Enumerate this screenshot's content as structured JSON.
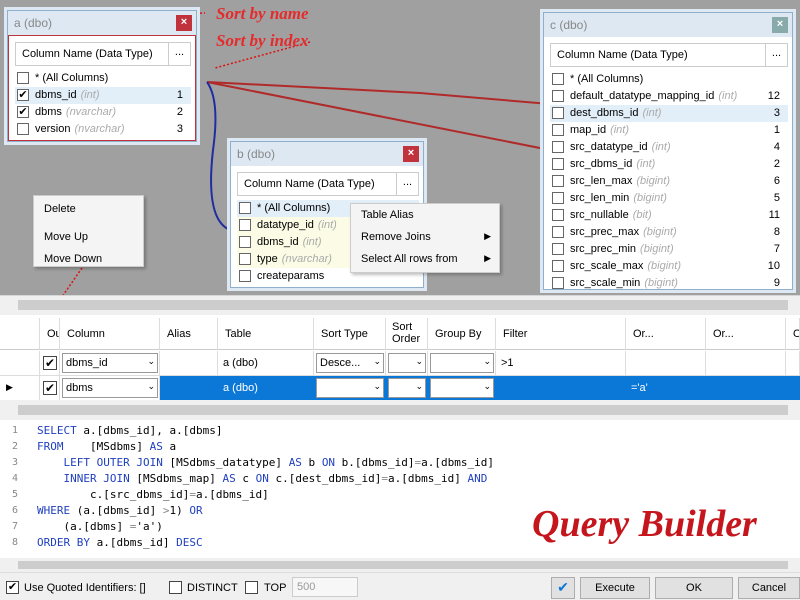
{
  "table_a": {
    "title": "a (dbo)",
    "header": "Column Name (Data Type)",
    "rows": [
      {
        "name": "* (All Columns)",
        "type": "",
        "index": "",
        "checked": ""
      },
      {
        "name": "dbms_id",
        "type": "(int)",
        "index": "1",
        "checked": "✔"
      },
      {
        "name": "dbms",
        "type": "(nvarchar)",
        "index": "2",
        "checked": "✔"
      },
      {
        "name": "version",
        "type": "(nvarchar)",
        "index": "3",
        "checked": ""
      }
    ]
  },
  "table_b": {
    "title": "b (dbo)",
    "header": "Column Name (Data Type)",
    "rows": [
      {
        "name": "* (All Columns)",
        "type": ""
      },
      {
        "name": "datatype_id",
        "type": "(int)"
      },
      {
        "name": "dbms_id",
        "type": "(int)"
      },
      {
        "name": "type",
        "type": "(nvarchar)"
      },
      {
        "name": "createparams",
        "type": ""
      }
    ]
  },
  "table_c": {
    "title": "c (dbo)",
    "header": "Column Name (Data Type)",
    "rows": [
      {
        "name": "* (All Columns)",
        "type": "",
        "index": ""
      },
      {
        "name": "default_datatype_mapping_id",
        "type": "(int)",
        "index": "12"
      },
      {
        "name": "dest_dbms_id",
        "type": "(int)",
        "index": "3"
      },
      {
        "name": "map_id",
        "type": "(int)",
        "index": "1"
      },
      {
        "name": "src_datatype_id",
        "type": "(int)",
        "index": "4"
      },
      {
        "name": "src_dbms_id",
        "type": "(int)",
        "index": "2"
      },
      {
        "name": "src_len_max",
        "type": "(bigint)",
        "index": "6"
      },
      {
        "name": "src_len_min",
        "type": "(bigint)",
        "index": "5"
      },
      {
        "name": "src_nullable",
        "type": "(bit)",
        "index": "11"
      },
      {
        "name": "src_prec_max",
        "type": "(bigint)",
        "index": "8"
      },
      {
        "name": "src_prec_min",
        "type": "(bigint)",
        "index": "7"
      },
      {
        "name": "src_scale_max",
        "type": "(bigint)",
        "index": "10"
      },
      {
        "name": "src_scale_min",
        "type": "(bigint)",
        "index": "9"
      }
    ]
  },
  "menu_left": {
    "items": [
      "Delete",
      "Move Up",
      "Move Down"
    ]
  },
  "menu_right": {
    "items": [
      "Table Alias",
      "Remove Joins",
      "Select All rows from"
    ]
  },
  "annotations": {
    "sort_name": "Sort by name",
    "sort_index": "Sort by index"
  },
  "grid": {
    "headers": [
      "Ou",
      "Column",
      "Alias",
      "Table",
      "Sort Type",
      "Sort Order",
      "Group By",
      "Filter",
      "Or...",
      "Or...",
      "Or"
    ],
    "rows": [
      {
        "column": "dbms_id",
        "alias": "",
        "table": "a (dbo)",
        "sort_type": "Desce...",
        "sort_order": "",
        "group_by": "",
        "filter": ">1",
        "or1": "",
        "or2": ""
      },
      {
        "column": "dbms",
        "alias": "",
        "table": "a (dbo)",
        "sort_type": "",
        "sort_order": "",
        "group_by": "",
        "filter": "",
        "or1": "='a'",
        "or2": ""
      }
    ]
  },
  "sql": {
    "line_numbers": [
      "1",
      "2",
      "3",
      "4",
      "5",
      "6",
      "7",
      "8"
    ]
  },
  "bottom": {
    "quoted": "Use Quoted Identifiers: []",
    "distinct": "DISTINCT",
    "top": "TOP",
    "top_value": "500",
    "execute": "Execute",
    "ok": "OK",
    "cancel": "Cancel"
  },
  "brand_title": "Query Builder",
  "colors": {
    "accent": "#0b78d7",
    "close": "#c0333d",
    "annotation": "#e52b2b",
    "brand": "#c4161c",
    "keyword": "#1f3fbf"
  }
}
